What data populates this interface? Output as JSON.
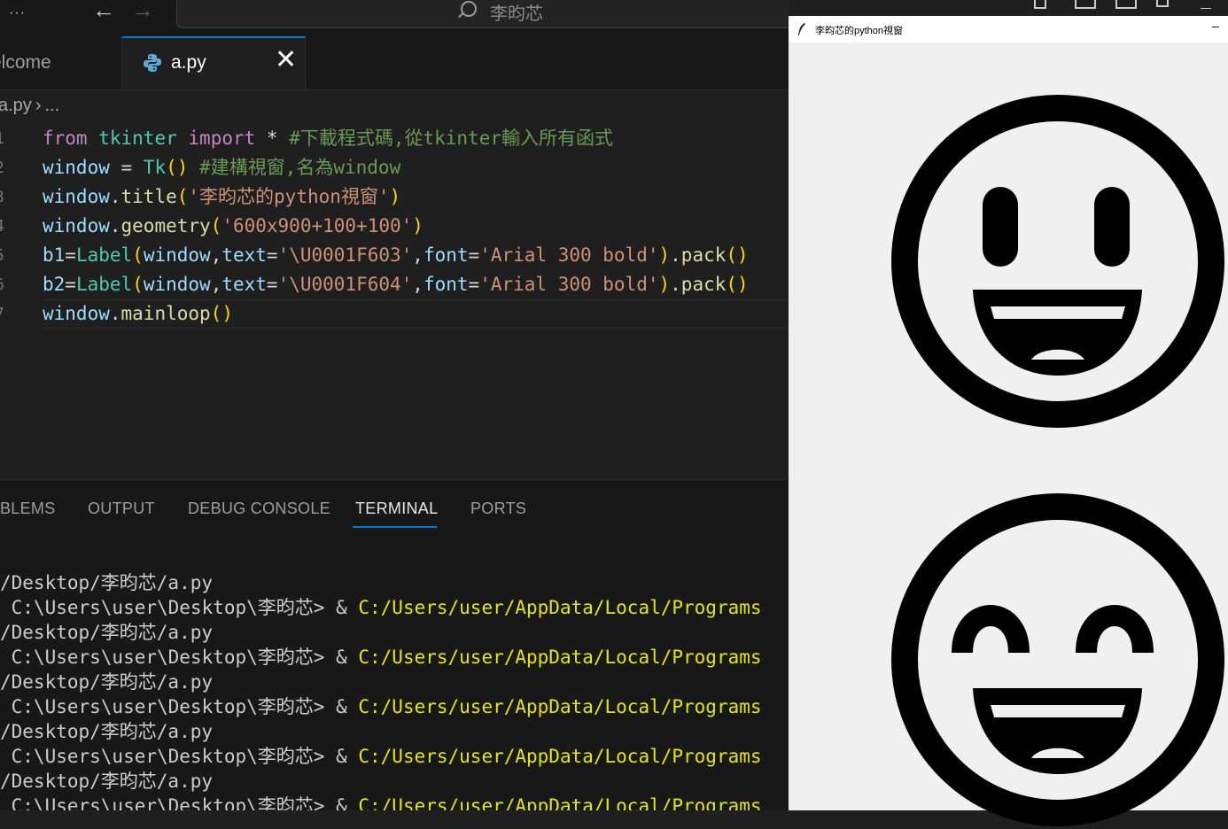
{
  "vscode": {
    "titlebar": {
      "more_label": "···",
      "back_icon": "←",
      "forward_icon": "→",
      "search_text": "李昀芯"
    },
    "tabs": [
      {
        "label": "Welcome",
        "display": "elcome"
      },
      {
        "label": "a.py",
        "close": "✕"
      }
    ],
    "breadcrumb": {
      "file": "a.py",
      "sep": "›",
      "more": "..."
    },
    "code_lines": [
      {
        "n": "1",
        "tokens": [
          [
            "kw",
            "from"
          ],
          [
            "op",
            " "
          ],
          [
            "mod",
            "tkinter"
          ],
          [
            "op",
            " "
          ],
          [
            "kw",
            "import"
          ],
          [
            "op",
            " * "
          ],
          [
            "cm",
            "#下載程式碼,從tkinter輸入所有函式"
          ]
        ]
      },
      {
        "n": "2",
        "tokens": [
          [
            "id",
            "window"
          ],
          [
            "op",
            " = "
          ],
          [
            "cls",
            "Tk"
          ],
          [
            "p1",
            "()"
          ],
          [
            "op",
            " "
          ],
          [
            "cm",
            "#建構視窗,名為window"
          ]
        ]
      },
      {
        "n": "3",
        "tokens": [
          [
            "id",
            "window"
          ],
          [
            "op",
            "."
          ],
          [
            "fn",
            "title"
          ],
          [
            "p1",
            "("
          ],
          [
            "str",
            "'李昀芯的python視窗'"
          ],
          [
            "p1",
            ")"
          ]
        ]
      },
      {
        "n": "4",
        "tokens": [
          [
            "id",
            "window"
          ],
          [
            "op",
            "."
          ],
          [
            "fn",
            "geometry"
          ],
          [
            "p1",
            "("
          ],
          [
            "str",
            "'600x900+100+100'"
          ],
          [
            "p1",
            ")"
          ]
        ]
      },
      {
        "n": "5",
        "tokens": [
          [
            "id",
            "b1"
          ],
          [
            "op",
            "="
          ],
          [
            "cls",
            "Label"
          ],
          [
            "p1",
            "("
          ],
          [
            "id",
            "window"
          ],
          [
            "op",
            ","
          ],
          [
            "id",
            "text"
          ],
          [
            "op",
            "="
          ],
          [
            "str",
            "'\\U0001F603'"
          ],
          [
            "op",
            ","
          ],
          [
            "id",
            "font"
          ],
          [
            "op",
            "="
          ],
          [
            "str",
            "'Arial 300 bold'"
          ],
          [
            "p1",
            ")"
          ],
          [
            "op",
            "."
          ],
          [
            "fn",
            "pack"
          ],
          [
            "p1",
            "()"
          ]
        ]
      },
      {
        "n": "6",
        "tokens": [
          [
            "id",
            "b2"
          ],
          [
            "op",
            "="
          ],
          [
            "cls",
            "Label"
          ],
          [
            "p1",
            "("
          ],
          [
            "id",
            "window"
          ],
          [
            "op",
            ","
          ],
          [
            "id",
            "text"
          ],
          [
            "op",
            "="
          ],
          [
            "str",
            "'\\U0001F604'"
          ],
          [
            "op",
            ","
          ],
          [
            "id",
            "font"
          ],
          [
            "op",
            "="
          ],
          [
            "str",
            "'Arial 300 bold'"
          ],
          [
            "p1",
            ")"
          ],
          [
            "op",
            "."
          ],
          [
            "fn",
            "pack"
          ],
          [
            "p1",
            "()"
          ]
        ]
      },
      {
        "n": "7",
        "tokens": [
          [
            "id",
            "window"
          ],
          [
            "op",
            "."
          ],
          [
            "fn",
            "mainloop"
          ],
          [
            "p1",
            "()"
          ]
        ]
      }
    ],
    "panel_tabs": [
      {
        "label": "BLEMS",
        "active": false
      },
      {
        "label": "OUTPUT",
        "active": false
      },
      {
        "label": "DEBUG CONSOLE",
        "active": false
      },
      {
        "label": "TERMINAL",
        "active": true
      },
      {
        "label": "PORTS",
        "active": false
      }
    ],
    "terminal_lines": [
      {
        "text": "/Desktop/李昀芯/a.py"
      },
      {
        "text": " C:\\Users\\user\\Desktop\\李昀芯> & ",
        "path": "C:/Users/user/AppData/Local/Programs"
      },
      {
        "text": "/Desktop/李昀芯/a.py"
      },
      {
        "text": " C:\\Users\\user\\Desktop\\李昀芯> & ",
        "path": "C:/Users/user/AppData/Local/Programs"
      },
      {
        "text": "/Desktop/李昀芯/a.py"
      },
      {
        "text": " C:\\Users\\user\\Desktop\\李昀芯> & ",
        "path": "C:/Users/user/AppData/Local/Programs"
      },
      {
        "text": "/Desktop/李昀芯/a.py"
      },
      {
        "text": " C:\\Users\\user\\Desktop\\李昀芯> & ",
        "path": "C:/Users/user/AppData/Local/Programs"
      },
      {
        "text": "/Desktop/李昀芯/a.py"
      },
      {
        "text": " C:\\Users\\user\\Desktop\\李昀芯> & ",
        "path": "C:/Users/user/AppData/Local/Programs"
      }
    ]
  },
  "tk_window": {
    "title": "李昀芯的python視窗",
    "minimize": "–",
    "emojis": [
      {
        "name": "smiling-face-open-mouth-icon",
        "code": "\\U0001F603"
      },
      {
        "name": "smiling-face-smiling-eyes-icon",
        "code": "\\U0001F604"
      }
    ]
  },
  "colors": {
    "editor_bg": "#1f1f1f",
    "tab_accent": "#0078d4",
    "tk_bg": "#f0f0f0"
  }
}
